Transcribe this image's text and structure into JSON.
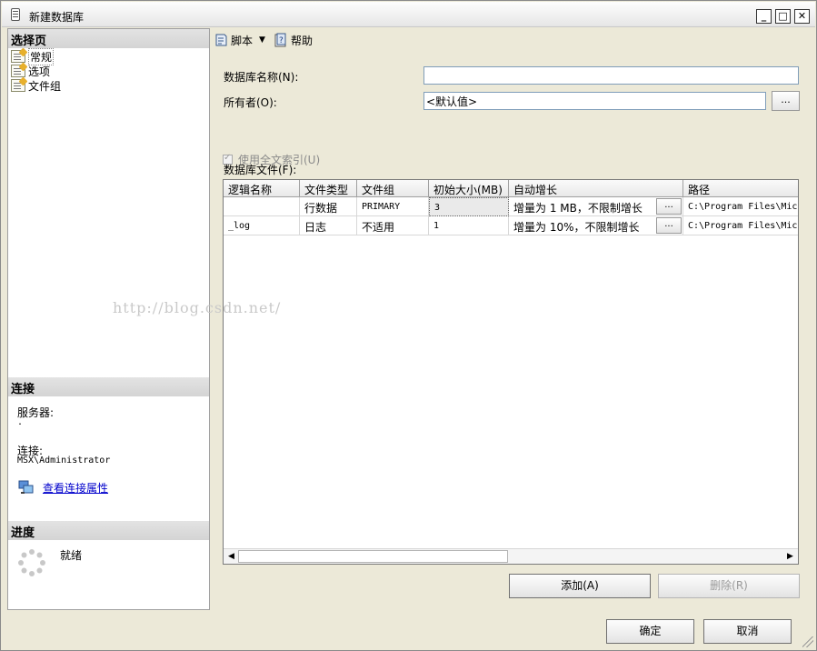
{
  "window": {
    "title": "新建数据库",
    "minimize": "_",
    "maximize": "□",
    "close": "✕"
  },
  "left": {
    "select_page_header": "选择页",
    "nav_items": [
      {
        "label": "常规",
        "icon": "page-icon"
      },
      {
        "label": "选项",
        "icon": "page-icon"
      },
      {
        "label": "文件组",
        "icon": "page-icon"
      }
    ],
    "connection_header": "连接",
    "server_label": "服务器:",
    "server_value": ".",
    "connection_label": "连接:",
    "connection_value": "MSX\\Administrator",
    "view_props_link": "查看连接属性",
    "progress_header": "进度",
    "progress_status": "就绪"
  },
  "toolbar": {
    "script_label": "脚本",
    "help_label": "帮助"
  },
  "form": {
    "dbname_label": "数据库名称(N):",
    "dbname_value": "",
    "owner_label": "所有者(O):",
    "owner_value": "<默认值>",
    "browse": "...",
    "fulltext_label": "使用全文索引(U)",
    "files_label": "数据库文件(F):"
  },
  "grid": {
    "columns": [
      "逻辑名称",
      "文件类型",
      "文件组",
      "初始大小(MB)",
      "自动增长",
      "路径"
    ],
    "rows": [
      [
        "",
        "行数据",
        "PRIMARY",
        "3",
        "增量为 1 MB，不限制增长",
        "C:\\Program Files\\Mic"
      ],
      [
        "_log",
        "日志",
        "不适用",
        "1",
        "增量为 10%，不限制增长",
        "C:\\Program Files\\Mic"
      ]
    ]
  },
  "buttons": {
    "add": "添加(A)",
    "remove": "删除(R)",
    "ok": "确定",
    "cancel": "取消"
  },
  "watermark": "http://blog.csdn.net/"
}
